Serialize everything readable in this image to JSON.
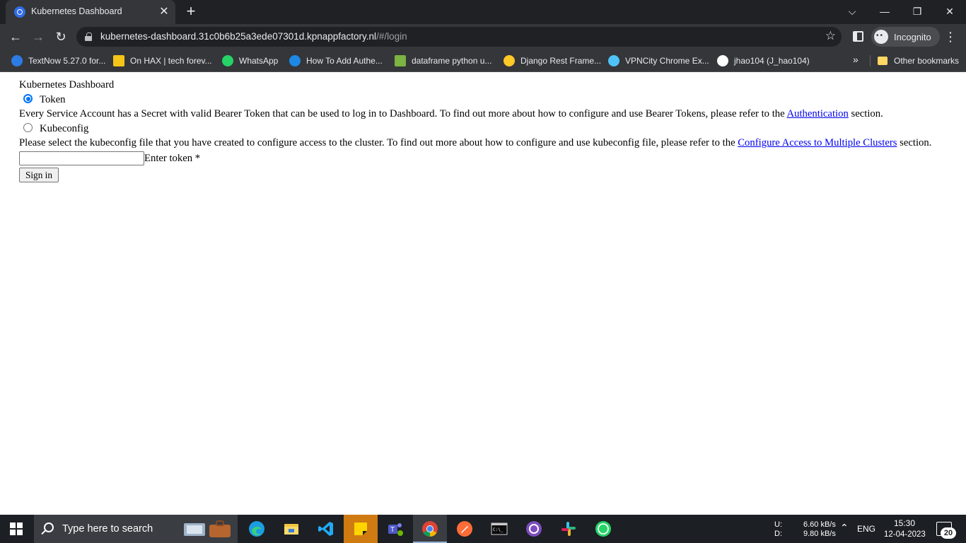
{
  "browser": {
    "tab_title": "Kubernetes Dashboard",
    "tab_close": "✕",
    "new_tab": "+",
    "url_host": "kubernetes-dashboard.31c0b6b25a3ede07301d.kpnappfactory.nl",
    "url_path": "/#/login",
    "incognito_label": "Incognito",
    "window_controls": {
      "dropdown": "⌵",
      "minimize": "—",
      "restore": "❐",
      "close": "✕"
    }
  },
  "bookmarks": [
    {
      "label": "TextNow 5.27.0 for...",
      "color": "#2d7be5"
    },
    {
      "label": "On HAX | tech forev...",
      "color": "#f5c518"
    },
    {
      "label": "WhatsApp",
      "color": "#25d366"
    },
    {
      "label": "How To Add Authe...",
      "color": "#1e88e5"
    },
    {
      "label": "dataframe python u...",
      "color": "#7cb342"
    },
    {
      "label": "Django Rest Frame...",
      "color": "#ffca28"
    },
    {
      "label": "VPNCity Chrome Ex...",
      "color": "#4fc3f7"
    },
    {
      "label": "jhao104 (J_hao104)",
      "color": "#ffffff"
    }
  ],
  "bookmarks_more": "»",
  "other_bookmarks": "Other bookmarks",
  "page": {
    "title": "Kubernetes Dashboard",
    "token_option": "Token",
    "token_desc": "Every Service Account has a Secret with valid Bearer Token that can be used to log in to Dashboard. To find out more about how to configure and use Bearer Tokens, please refer to the ",
    "token_link": "Authentication",
    "token_desc_end": " section.",
    "kubeconfig_option": "Kubeconfig",
    "kubeconfig_desc": "Please select the kubeconfig file that you have created to configure access to the cluster. To find out more about how to configure and use kubeconfig file, please refer to the ",
    "kubeconfig_link": "Configure Access to Multiple Clusters",
    "kubeconfig_desc_end": " section.",
    "token_input_value": "",
    "token_input_label": "Enter token *",
    "signin_label": "Sign in",
    "selected_option": "Token"
  },
  "taskbar": {
    "search_placeholder": "Type here to search",
    "net_up_label": "U:",
    "net_down_label": "D:",
    "net_up": "6.60 kB/s",
    "net_down": "9.80 kB/s",
    "language": "ENG",
    "time": "15:30",
    "date": "12-04-2023",
    "notifications": "20"
  }
}
